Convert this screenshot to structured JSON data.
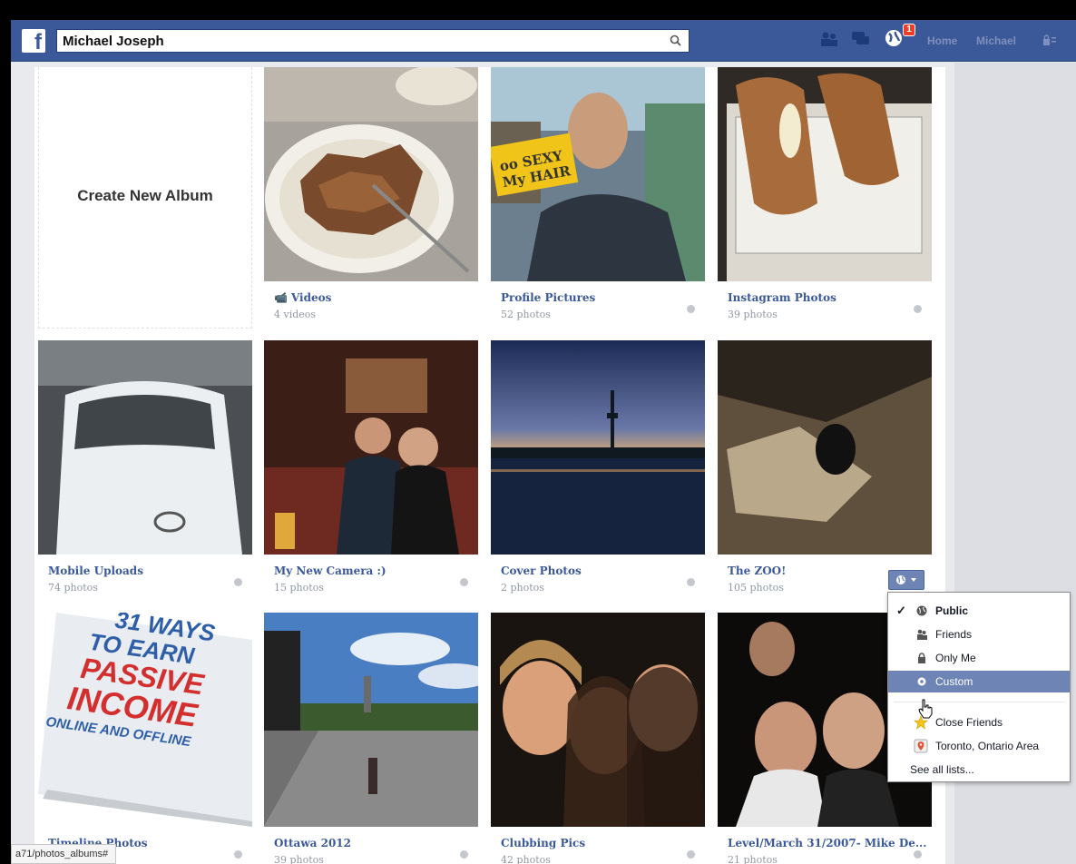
{
  "header": {
    "logo": "f",
    "search_value": "Michael Joseph",
    "notifications_count": "1",
    "nav": [
      "Home",
      "Michael"
    ]
  },
  "create_album": {
    "label": "Create New Album"
  },
  "albums": [
    {
      "title": "Videos",
      "count": "4 videos",
      "privacy": "",
      "is_video": true
    },
    {
      "title": "Profile Pictures",
      "count": "52 photos"
    },
    {
      "title": "Instagram Photos",
      "count": "39 photos"
    },
    {
      "title": "Mobile Uploads",
      "count": "74 photos"
    },
    {
      "title": "My New Camera :)",
      "count": "15 photos"
    },
    {
      "title": "Cover Photos",
      "count": "2 photos"
    },
    {
      "title": "The ZOO!",
      "count": "105 photos"
    },
    {
      "title": "Timeline Photos",
      "count": ""
    },
    {
      "title": "Ottawa 2012",
      "count": "39 photos"
    },
    {
      "title": "Clubbing Pics",
      "count": "42 photos"
    },
    {
      "title": "Level/March 31/2007- Mike De...",
      "count": "21 photos"
    }
  ],
  "thumb_text": {
    "profile_sign": [
      "oo SEXY",
      "My HAIR"
    ],
    "book": [
      "31 WAYS",
      "TO EARN",
      "PASSIVE",
      "INCOME",
      "ONLINE AND OFFLINE"
    ]
  },
  "privacy_menu": {
    "selected": "Public",
    "items": [
      "Public",
      "Friends",
      "Only Me",
      "Custom"
    ],
    "lists": [
      "Close Friends",
      "Toronto, Ontario Area"
    ],
    "see_all": "See all lists..."
  },
  "status_bar": {
    "url": "a71/photos_albums#"
  },
  "colors": {
    "brand": "#3b5998",
    "menu_highlight": "#6d84b4",
    "badge": "#f03d25"
  }
}
